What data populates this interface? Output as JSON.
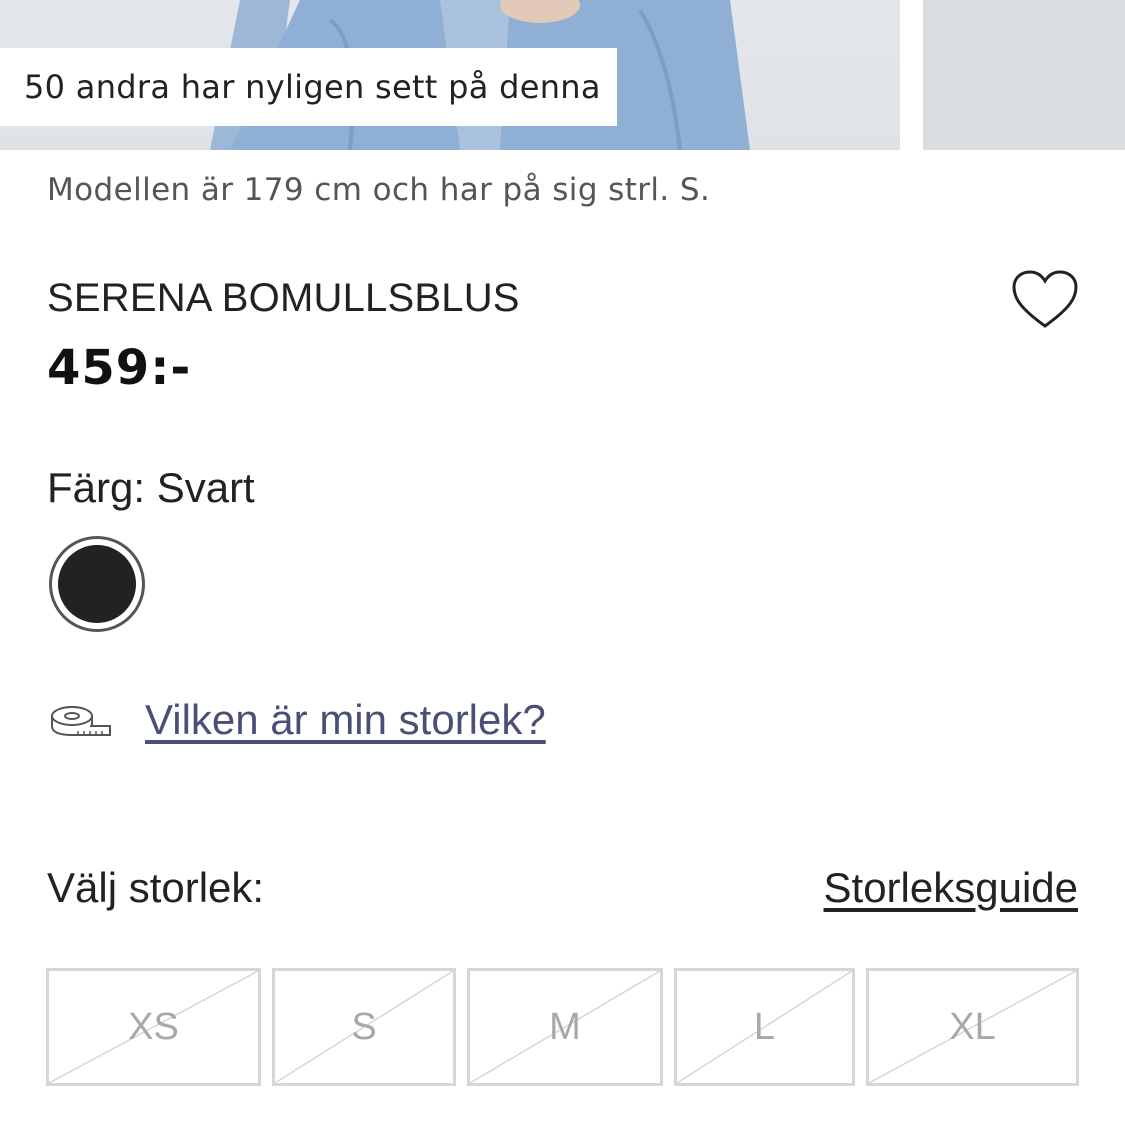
{
  "gallery": {
    "viewers_text": "50 andra har nyligen sett på denna"
  },
  "model_info": "Modellen är 179 cm och har på sig strl. S.",
  "product": {
    "name": "SERENA BOMULLSBLUS",
    "price": "459:-"
  },
  "color": {
    "label": "Färg: Svart",
    "swatch_hex": "#222222"
  },
  "fit": {
    "link_text": "Vilken är min storlek?",
    "icon": "tape-measure-icon"
  },
  "sizes": {
    "label": "Välj storlek:",
    "guide_link": "Storleksguide",
    "options": [
      {
        "label": "XS",
        "available": false
      },
      {
        "label": "S",
        "available": false
      },
      {
        "label": "M",
        "available": false
      },
      {
        "label": "L",
        "available": false
      },
      {
        "label": "XL",
        "available": false
      }
    ]
  },
  "colors": {
    "link": "#4a4f78",
    "unavailable_text": "#a8a8a8",
    "box_border": "#d6d6d6"
  }
}
